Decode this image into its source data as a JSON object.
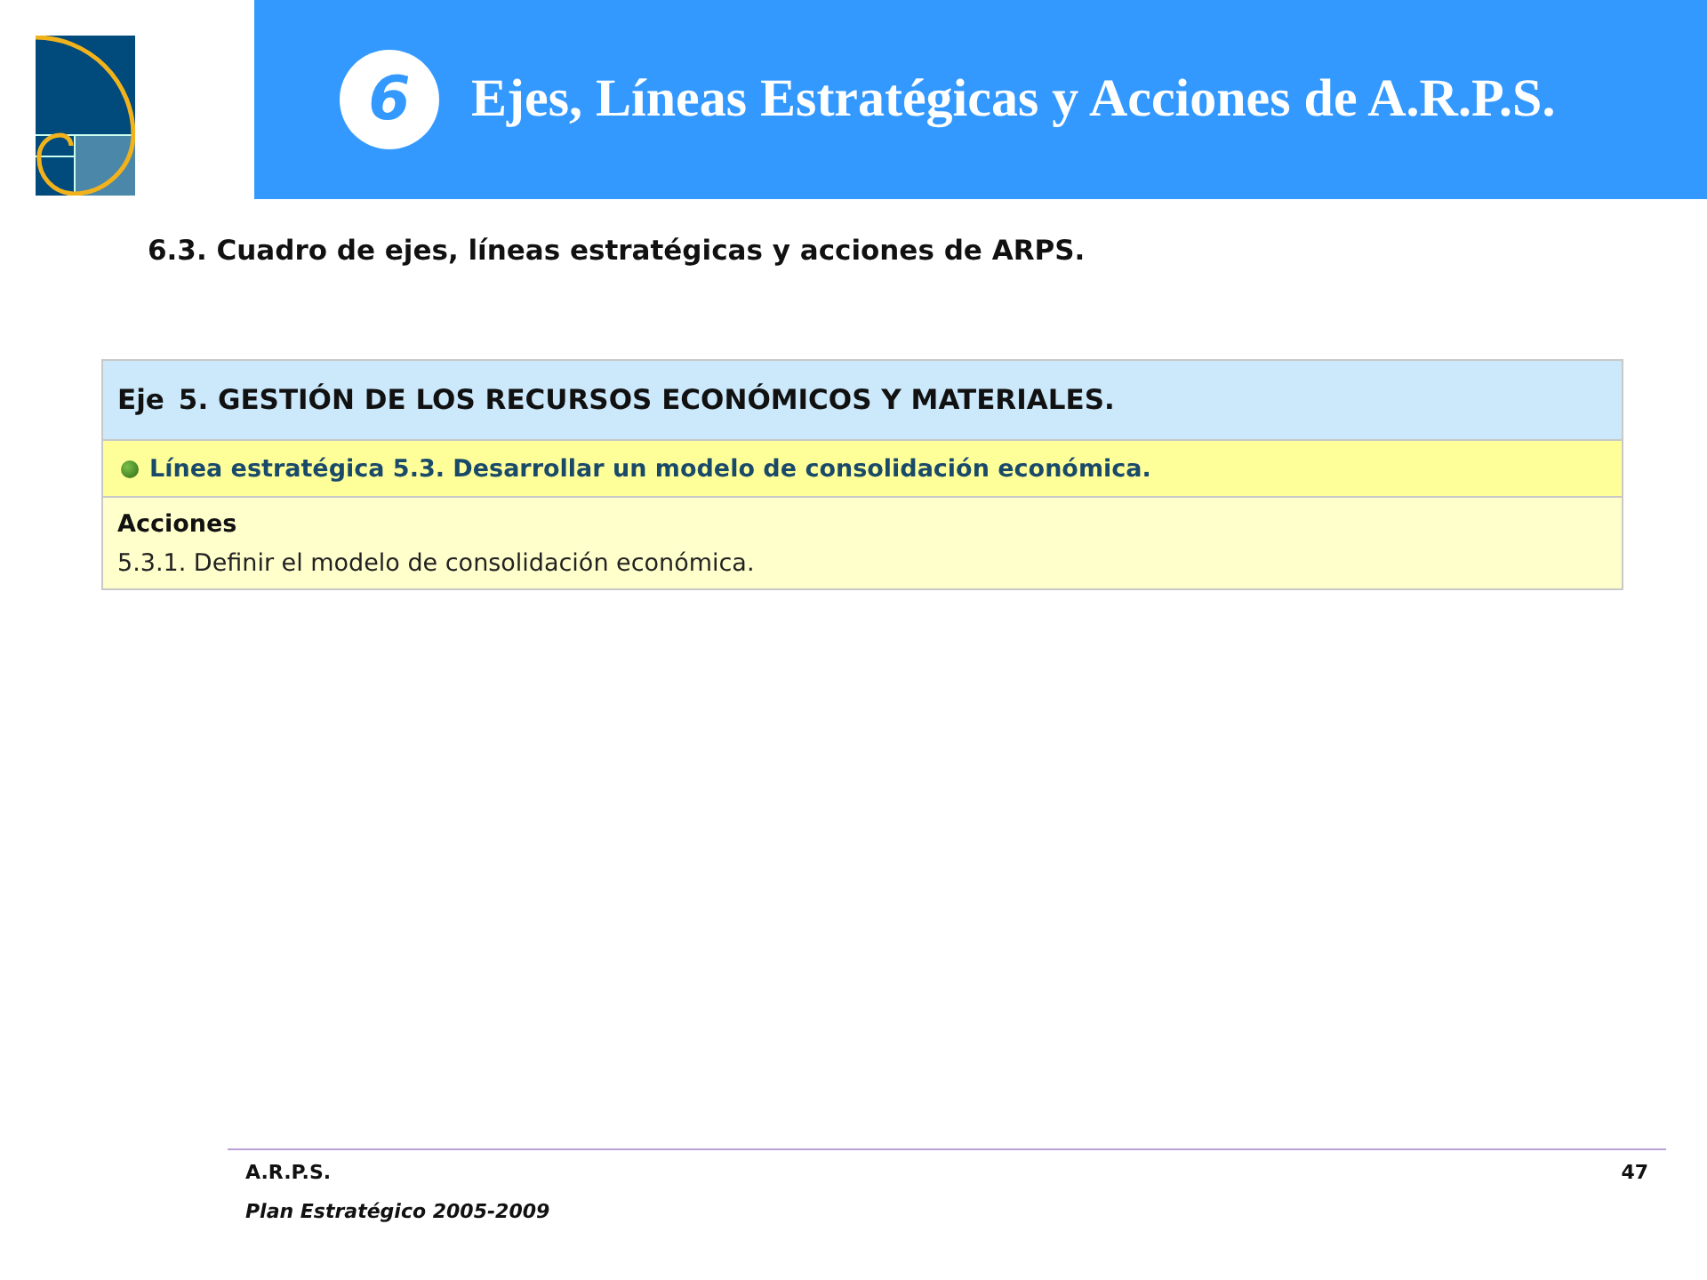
{
  "header": {
    "chapter_number": "6",
    "title": "Ejes, Líneas Estratégicas y Acciones de A.R.P.S."
  },
  "section_title": "6.3. Cuadro de ejes, líneas estratégicas y acciones de ARPS.",
  "table": {
    "axis": {
      "label": "Eje",
      "title": "5. GESTIÓN DE LOS RECURSOS ECONÓMICOS Y MATERIALES."
    },
    "line": "Línea estratégica 5.3. Desarrollar un modelo de consolidación económica.",
    "actions_heading": "Acciones",
    "actions": [
      "5.3.1. Definir el modelo de consolidación económica."
    ]
  },
  "footer": {
    "organization": "A.R.P.S.",
    "page_number": "47",
    "plan": "Plan Estratégico 2005-2009"
  }
}
